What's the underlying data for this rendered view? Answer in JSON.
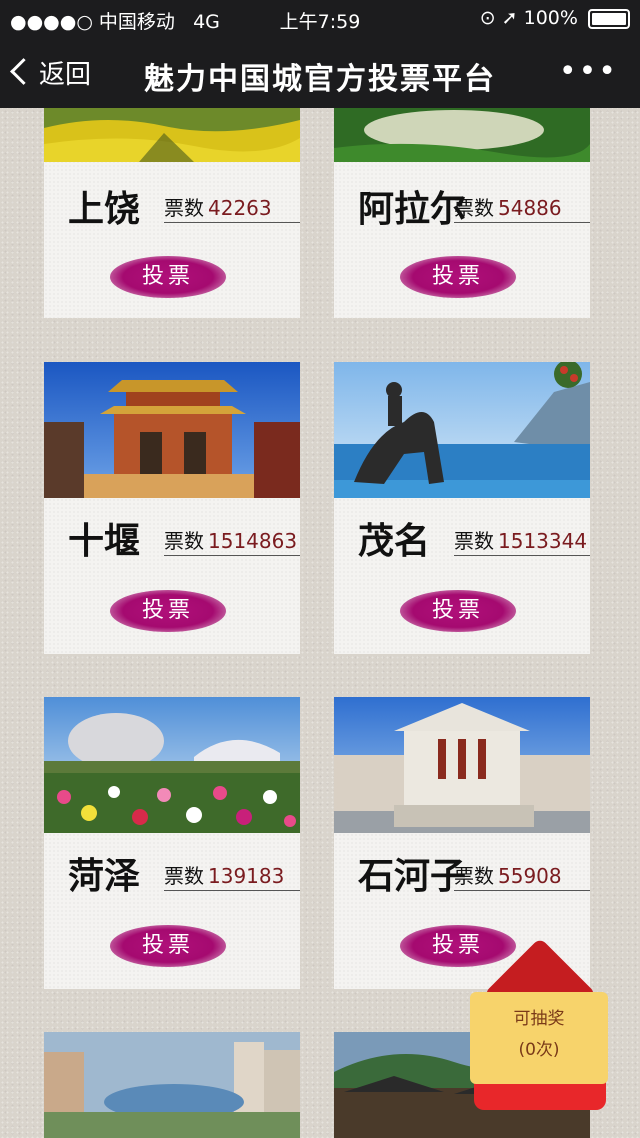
{
  "status_bar": {
    "carrier": "●●●●○ 中国移动",
    "network": "4G",
    "time": "上午7:59",
    "battery": "100%"
  },
  "nav": {
    "back_label": "返回",
    "title": "魅力中国城官方投票平台",
    "more_label": "•••"
  },
  "vote_label": "投票",
  "votes_prefix": "票数",
  "cities": [
    {
      "name": "上饶",
      "votes": "42263"
    },
    {
      "name": "阿拉尔",
      "votes": "54886"
    },
    {
      "name": "十堰",
      "votes": "1514863"
    },
    {
      "name": "茂名",
      "votes": "1513344"
    },
    {
      "name": "菏泽",
      "votes": "139183"
    },
    {
      "name": "石河子",
      "votes": "55908"
    }
  ],
  "lottery": {
    "line1": "可抽奖",
    "line2": "(0次)"
  },
  "colors": {
    "bar_bg": "#1c1c1e",
    "vote_button": "#a50a70",
    "vote_number": "#7a1b1f",
    "envelope_red": "#e8272a"
  }
}
